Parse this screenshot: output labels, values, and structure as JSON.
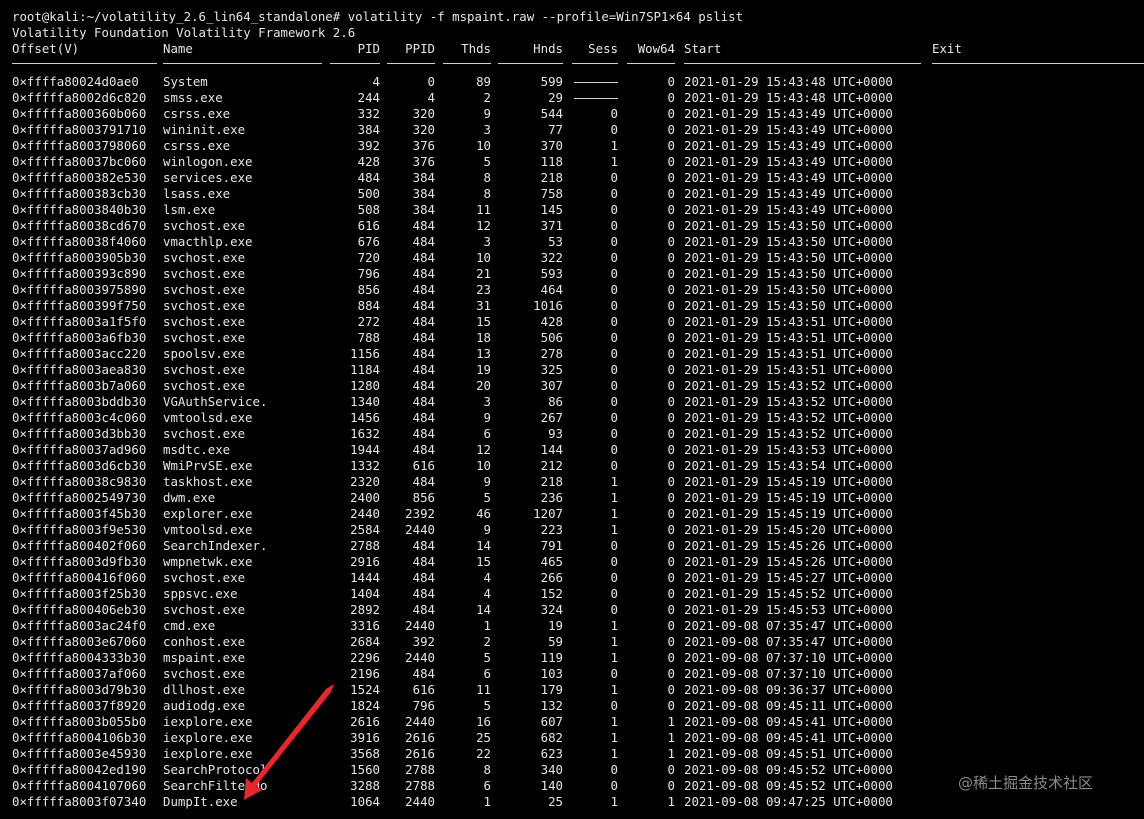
{
  "terminal": {
    "command_line": "root@kali:~/volatility_2.6_lin64_standalone# volatility -f mspaint.raw --profile=Win7SP1×64 pslist",
    "banner": "Volatility Foundation Volatility Framework 2.6",
    "headers": {
      "offset": "Offset(V)",
      "name": "Name",
      "pid": "PID",
      "ppid": "PPID",
      "thds": "Thds",
      "hnds": "Hnds",
      "sess": "Sess",
      "wow64": "Wow64",
      "start": "Start",
      "exit": "Exit"
    },
    "rows": [
      {
        "offset": "0×ffffa80024d0ae0",
        "name": "System",
        "pid": "4",
        "ppid": "0",
        "thds": "89",
        "hnds": "599",
        "sess": "------",
        "wow64": "0",
        "start": "2021-01-29 15:43:48 UTC+0000"
      },
      {
        "offset": "0×fffffa8002d6c820",
        "name": "smss.exe",
        "pid": "244",
        "ppid": "4",
        "thds": "2",
        "hnds": "29",
        "sess": "------",
        "wow64": "0",
        "start": "2021-01-29 15:43:48 UTC+0000"
      },
      {
        "offset": "0×fffffa800360b060",
        "name": "csrss.exe",
        "pid": "332",
        "ppid": "320",
        "thds": "9",
        "hnds": "544",
        "sess": "0",
        "wow64": "0",
        "start": "2021-01-29 15:43:49 UTC+0000"
      },
      {
        "offset": "0×fffffa8003791710",
        "name": "wininit.exe",
        "pid": "384",
        "ppid": "320",
        "thds": "3",
        "hnds": "77",
        "sess": "0",
        "wow64": "0",
        "start": "2021-01-29 15:43:49 UTC+0000"
      },
      {
        "offset": "0×fffffa8003798060",
        "name": "csrss.exe",
        "pid": "392",
        "ppid": "376",
        "thds": "10",
        "hnds": "370",
        "sess": "1",
        "wow64": "0",
        "start": "2021-01-29 15:43:49 UTC+0000"
      },
      {
        "offset": "0×fffffa80037bc060",
        "name": "winlogon.exe",
        "pid": "428",
        "ppid": "376",
        "thds": "5",
        "hnds": "118",
        "sess": "1",
        "wow64": "0",
        "start": "2021-01-29 15:43:49 UTC+0000"
      },
      {
        "offset": "0×fffffa800382e530",
        "name": "services.exe",
        "pid": "484",
        "ppid": "384",
        "thds": "8",
        "hnds": "218",
        "sess": "0",
        "wow64": "0",
        "start": "2021-01-29 15:43:49 UTC+0000"
      },
      {
        "offset": "0×fffffa800383cb30",
        "name": "lsass.exe",
        "pid": "500",
        "ppid": "384",
        "thds": "8",
        "hnds": "758",
        "sess": "0",
        "wow64": "0",
        "start": "2021-01-29 15:43:49 UTC+0000"
      },
      {
        "offset": "0×fffffa8003840b30",
        "name": "lsm.exe",
        "pid": "508",
        "ppid": "384",
        "thds": "11",
        "hnds": "145",
        "sess": "0",
        "wow64": "0",
        "start": "2021-01-29 15:43:49 UTC+0000"
      },
      {
        "offset": "0×fffffa80038cd670",
        "name": "svchost.exe",
        "pid": "616",
        "ppid": "484",
        "thds": "12",
        "hnds": "371",
        "sess": "0",
        "wow64": "0",
        "start": "2021-01-29 15:43:50 UTC+0000"
      },
      {
        "offset": "0×fffffa80038f4060",
        "name": "vmacthlp.exe",
        "pid": "676",
        "ppid": "484",
        "thds": "3",
        "hnds": "53",
        "sess": "0",
        "wow64": "0",
        "start": "2021-01-29 15:43:50 UTC+0000"
      },
      {
        "offset": "0×fffffa8003905b30",
        "name": "svchost.exe",
        "pid": "720",
        "ppid": "484",
        "thds": "10",
        "hnds": "322",
        "sess": "0",
        "wow64": "0",
        "start": "2021-01-29 15:43:50 UTC+0000"
      },
      {
        "offset": "0×fffffa800393c890",
        "name": "svchost.exe",
        "pid": "796",
        "ppid": "484",
        "thds": "21",
        "hnds": "593",
        "sess": "0",
        "wow64": "0",
        "start": "2021-01-29 15:43:50 UTC+0000"
      },
      {
        "offset": "0×fffffa8003975890",
        "name": "svchost.exe",
        "pid": "856",
        "ppid": "484",
        "thds": "23",
        "hnds": "464",
        "sess": "0",
        "wow64": "0",
        "start": "2021-01-29 15:43:50 UTC+0000"
      },
      {
        "offset": "0×fffffa800399f750",
        "name": "svchost.exe",
        "pid": "884",
        "ppid": "484",
        "thds": "31",
        "hnds": "1016",
        "sess": "0",
        "wow64": "0",
        "start": "2021-01-29 15:43:50 UTC+0000"
      },
      {
        "offset": "0×fffffa8003a1f5f0",
        "name": "svchost.exe",
        "pid": "272",
        "ppid": "484",
        "thds": "15",
        "hnds": "428",
        "sess": "0",
        "wow64": "0",
        "start": "2021-01-29 15:43:51 UTC+0000"
      },
      {
        "offset": "0×fffffa8003a6fb30",
        "name": "svchost.exe",
        "pid": "788",
        "ppid": "484",
        "thds": "18",
        "hnds": "506",
        "sess": "0",
        "wow64": "0",
        "start": "2021-01-29 15:43:51 UTC+0000"
      },
      {
        "offset": "0×fffffa8003acc220",
        "name": "spoolsv.exe",
        "pid": "1156",
        "ppid": "484",
        "thds": "13",
        "hnds": "278",
        "sess": "0",
        "wow64": "0",
        "start": "2021-01-29 15:43:51 UTC+0000"
      },
      {
        "offset": "0×fffffa8003aea830",
        "name": "svchost.exe",
        "pid": "1184",
        "ppid": "484",
        "thds": "19",
        "hnds": "325",
        "sess": "0",
        "wow64": "0",
        "start": "2021-01-29 15:43:51 UTC+0000"
      },
      {
        "offset": "0×fffffa8003b7a060",
        "name": "svchost.exe",
        "pid": "1280",
        "ppid": "484",
        "thds": "20",
        "hnds": "307",
        "sess": "0",
        "wow64": "0",
        "start": "2021-01-29 15:43:52 UTC+0000"
      },
      {
        "offset": "0×fffffa8003bddb30",
        "name": "VGAuthService.",
        "pid": "1340",
        "ppid": "484",
        "thds": "3",
        "hnds": "86",
        "sess": "0",
        "wow64": "0",
        "start": "2021-01-29 15:43:52 UTC+0000"
      },
      {
        "offset": "0×fffffa8003c4c060",
        "name": "vmtoolsd.exe",
        "pid": "1456",
        "ppid": "484",
        "thds": "9",
        "hnds": "267",
        "sess": "0",
        "wow64": "0",
        "start": "2021-01-29 15:43:52 UTC+0000"
      },
      {
        "offset": "0×fffffa8003d3bb30",
        "name": "svchost.exe",
        "pid": "1632",
        "ppid": "484",
        "thds": "6",
        "hnds": "93",
        "sess": "0",
        "wow64": "0",
        "start": "2021-01-29 15:43:52 UTC+0000"
      },
      {
        "offset": "0×fffffa80037ad960",
        "name": "msdtc.exe",
        "pid": "1944",
        "ppid": "484",
        "thds": "12",
        "hnds": "144",
        "sess": "0",
        "wow64": "0",
        "start": "2021-01-29 15:43:53 UTC+0000"
      },
      {
        "offset": "0×fffffa8003d6cb30",
        "name": "WmiPrvSE.exe",
        "pid": "1332",
        "ppid": "616",
        "thds": "10",
        "hnds": "212",
        "sess": "0",
        "wow64": "0",
        "start": "2021-01-29 15:43:54 UTC+0000"
      },
      {
        "offset": "0×fffffa80038c9830",
        "name": "taskhost.exe",
        "pid": "2320",
        "ppid": "484",
        "thds": "9",
        "hnds": "218",
        "sess": "1",
        "wow64": "0",
        "start": "2021-01-29 15:45:19 UTC+0000"
      },
      {
        "offset": "0×fffffa8002549730",
        "name": "dwm.exe",
        "pid": "2400",
        "ppid": "856",
        "thds": "5",
        "hnds": "236",
        "sess": "1",
        "wow64": "0",
        "start": "2021-01-29 15:45:19 UTC+0000"
      },
      {
        "offset": "0×fffffa8003f45b30",
        "name": "explorer.exe",
        "pid": "2440",
        "ppid": "2392",
        "thds": "46",
        "hnds": "1207",
        "sess": "1",
        "wow64": "0",
        "start": "2021-01-29 15:45:19 UTC+0000"
      },
      {
        "offset": "0×fffffa8003f9e530",
        "name": "vmtoolsd.exe",
        "pid": "2584",
        "ppid": "2440",
        "thds": "9",
        "hnds": "223",
        "sess": "1",
        "wow64": "0",
        "start": "2021-01-29 15:45:20 UTC+0000"
      },
      {
        "offset": "0×fffffa800402f060",
        "name": "SearchIndexer.",
        "pid": "2788",
        "ppid": "484",
        "thds": "14",
        "hnds": "791",
        "sess": "0",
        "wow64": "0",
        "start": "2021-01-29 15:45:26 UTC+0000"
      },
      {
        "offset": "0×fffffa8003d9fb30",
        "name": "wmpnetwk.exe",
        "pid": "2916",
        "ppid": "484",
        "thds": "15",
        "hnds": "465",
        "sess": "0",
        "wow64": "0",
        "start": "2021-01-29 15:45:26 UTC+0000"
      },
      {
        "offset": "0×fffffa800416f060",
        "name": "svchost.exe",
        "pid": "1444",
        "ppid": "484",
        "thds": "4",
        "hnds": "266",
        "sess": "0",
        "wow64": "0",
        "start": "2021-01-29 15:45:27 UTC+0000"
      },
      {
        "offset": "0×fffffa8003f25b30",
        "name": "sppsvc.exe",
        "pid": "1404",
        "ppid": "484",
        "thds": "4",
        "hnds": "152",
        "sess": "0",
        "wow64": "0",
        "start": "2021-01-29 15:45:52 UTC+0000"
      },
      {
        "offset": "0×fffffa800406eb30",
        "name": "svchost.exe",
        "pid": "2892",
        "ppid": "484",
        "thds": "14",
        "hnds": "324",
        "sess": "0",
        "wow64": "0",
        "start": "2021-01-29 15:45:53 UTC+0000"
      },
      {
        "offset": "0×fffffa8003ac24f0",
        "name": "cmd.exe",
        "pid": "3316",
        "ppid": "2440",
        "thds": "1",
        "hnds": "19",
        "sess": "1",
        "wow64": "0",
        "start": "2021-09-08 07:35:47 UTC+0000"
      },
      {
        "offset": "0×fffffa8003e67060",
        "name": "conhost.exe",
        "pid": "2684",
        "ppid": "392",
        "thds": "2",
        "hnds": "59",
        "sess": "1",
        "wow64": "0",
        "start": "2021-09-08 07:35:47 UTC+0000"
      },
      {
        "offset": "0×fffffa8004333b30",
        "name": "mspaint.exe",
        "pid": "2296",
        "ppid": "2440",
        "thds": "5",
        "hnds": "119",
        "sess": "1",
        "wow64": "0",
        "start": "2021-09-08 07:37:10 UTC+0000"
      },
      {
        "offset": "0×fffffa80037af060",
        "name": "svchost.exe",
        "pid": "2196",
        "ppid": "484",
        "thds": "6",
        "hnds": "103",
        "sess": "0",
        "wow64": "0",
        "start": "2021-09-08 07:37:10 UTC+0000"
      },
      {
        "offset": "0×fffffa8003d79b30",
        "name": "dllhost.exe",
        "pid": "1524",
        "ppid": "616",
        "thds": "11",
        "hnds": "179",
        "sess": "1",
        "wow64": "0",
        "start": "2021-09-08 09:36:37 UTC+0000"
      },
      {
        "offset": "0×fffffa80037f8920",
        "name": "audiodg.exe",
        "pid": "1824",
        "ppid": "796",
        "thds": "5",
        "hnds": "132",
        "sess": "0",
        "wow64": "0",
        "start": "2021-09-08 09:45:11 UTC+0000"
      },
      {
        "offset": "0×fffffa8003b055b0",
        "name": "iexplore.exe",
        "pid": "2616",
        "ppid": "2440",
        "thds": "16",
        "hnds": "607",
        "sess": "1",
        "wow64": "1",
        "start": "2021-09-08 09:45:41 UTC+0000"
      },
      {
        "offset": "0×fffffa8004106b30",
        "name": "iexplore.exe",
        "pid": "3916",
        "ppid": "2616",
        "thds": "25",
        "hnds": "682",
        "sess": "1",
        "wow64": "1",
        "start": "2021-09-08 09:45:41 UTC+0000"
      },
      {
        "offset": "0×fffffa8003e45930",
        "name": "iexplore.exe",
        "pid": "3568",
        "ppid": "2616",
        "thds": "22",
        "hnds": "623",
        "sess": "1",
        "wow64": "1",
        "start": "2021-09-08 09:45:51 UTC+0000"
      },
      {
        "offset": "0×fffffa80042ed190",
        "name": "SearchProtocol",
        "pid": "1560",
        "ppid": "2788",
        "thds": "8",
        "hnds": "340",
        "sess": "0",
        "wow64": "0",
        "start": "2021-09-08 09:45:52 UTC+0000"
      },
      {
        "offset": "0×fffffa8004107060",
        "name": "SearchFilterHo",
        "pid": "3288",
        "ppid": "2788",
        "thds": "6",
        "hnds": "140",
        "sess": "0",
        "wow64": "0",
        "start": "2021-09-08 09:45:52 UTC+0000"
      },
      {
        "offset": "0×fffffa8003f07340",
        "name": "DumpIt.exe",
        "pid": "1064",
        "ppid": "2440",
        "thds": "1",
        "hnds": "25",
        "sess": "1",
        "wow64": "1",
        "start": "2021-09-08 09:47:25 UTC+0000"
      }
    ],
    "annotation": {
      "arrow_color": "#e8262b"
    }
  },
  "watermark": {
    "text": "@稀土掘金技术社区"
  }
}
